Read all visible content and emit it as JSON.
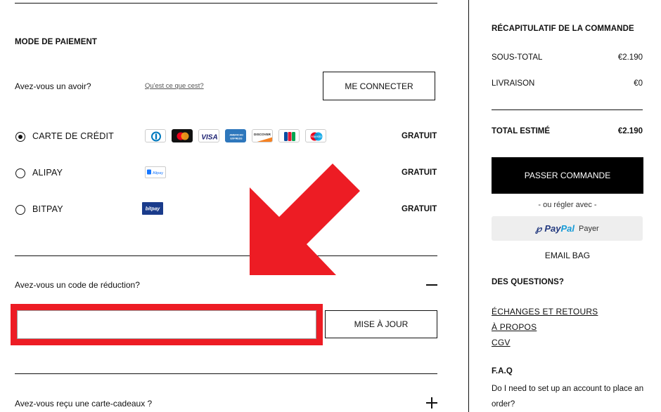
{
  "payment": {
    "title": "MODE DE PAIEMENT",
    "credit_question": "Avez-vous un avoir?",
    "credit_link": "Qu'est ce que cest?",
    "login_button": "ME CONNECTER",
    "methods": [
      {
        "label": "CARTE DE CRÉDIT",
        "price": "GRATUIT",
        "selected": true
      },
      {
        "label": "ALIPAY",
        "price": "GRATUIT",
        "selected": false
      },
      {
        "label": "BITPAY",
        "price": "GRATUIT",
        "selected": false
      }
    ],
    "card_icons": [
      "diners-icon",
      "mastercard-icon",
      "visa-icon",
      "amex-icon",
      "discover-icon",
      "jcb-icon",
      "maestro-icon"
    ],
    "card_text": {
      "visa": "VISA",
      "amex": "AMERICAN EXPRESS",
      "discover": "DISCOVER",
      "maestro": "Maestro",
      "alipay": "Alipay",
      "bitpay": "bitpay"
    }
  },
  "discount": {
    "question": "Avez-vous un code de réduction?",
    "toggle": "—",
    "input_value": "",
    "update_button": "MISE À JOUR"
  },
  "giftcard": {
    "question": "Avez-vous reçu une carte-cadeaux ?",
    "toggle": "+"
  },
  "summary": {
    "title": "RÉCAPITULATIF DE LA COMMANDE",
    "subtotal_label": "SOUS-TOTAL",
    "subtotal_value": "€2.190",
    "shipping_label": "LIVRAISON",
    "shipping_value": "€0",
    "total_label": "TOTAL ESTIMÉ",
    "total_value": "€2.190",
    "order_button": "PASSER COMMANDE",
    "or_pay_with": "- ou régler avec -",
    "paypal_brand_1": "Pay",
    "paypal_brand_2": "Pal",
    "paypal_pay": "Payer",
    "email_bag": "EMAIL BAG",
    "questions_title": "DES QUESTIONS?",
    "links": [
      "ÉCHANGES ET RETOURS",
      "À PROPOS",
      "CGV"
    ],
    "faq_title": "F.A.Q",
    "faq_question": "Do I need to set up an account to place an order?"
  },
  "colors": {
    "annotation_red": "#ed1c24",
    "paypal_dark": "#253b80",
    "paypal_light": "#179bd7"
  }
}
